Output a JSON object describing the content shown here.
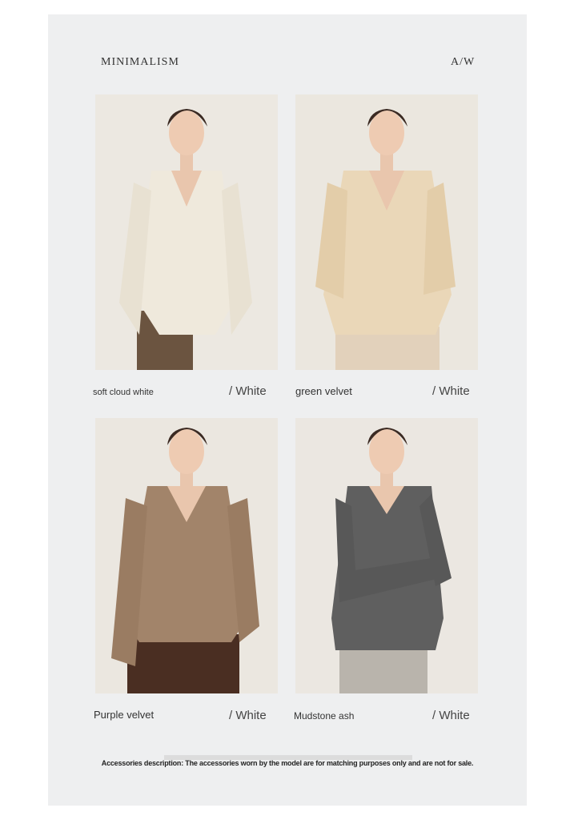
{
  "header": {
    "brand": "MINIMALISM",
    "season": "A/W"
  },
  "products": [
    {
      "name": "soft cloud white",
      "color_label": "/ White",
      "sweater_color": "#efe9dc",
      "pants_color": "#6b5440"
    },
    {
      "name": "green velvet",
      "color_label": "/ White",
      "sweater_color": "#ead7b8",
      "pants_color": "#e2d1bb"
    },
    {
      "name": "Purple velvet",
      "color_label": "/ White",
      "sweater_color": "#a2846a",
      "pants_color": "#4a2e22"
    },
    {
      "name": "Mudstone ash",
      "color_label": "/ White",
      "sweater_color": "#5f5f5f",
      "pants_color": "#b9b4ac"
    }
  ],
  "footer": {
    "note": "Accessories description: The accessories worn by the model are for matching purposes only and are not for sale."
  }
}
